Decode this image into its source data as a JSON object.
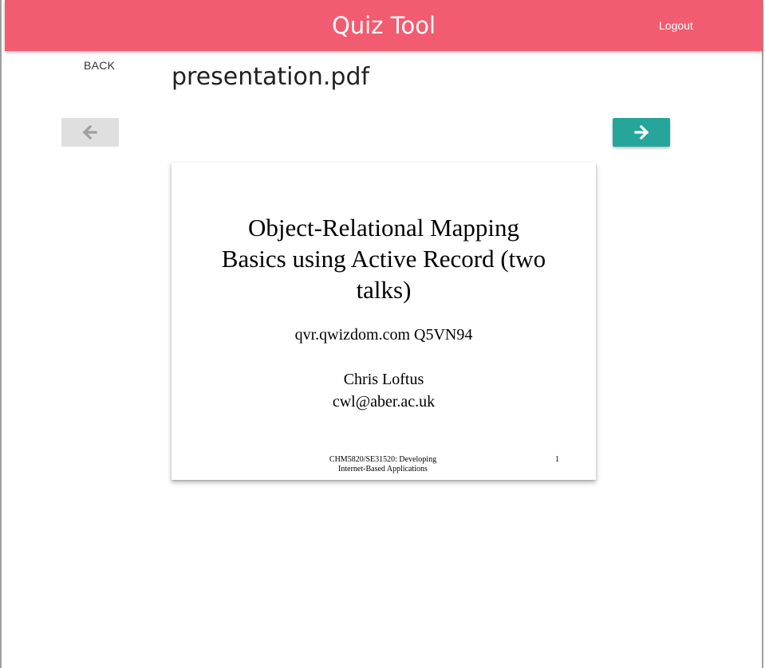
{
  "header": {
    "app_title": "Quiz Tool",
    "logout_label": "Logout",
    "bg_color": "#f25c70"
  },
  "toolbar": {
    "back_label": "BACK",
    "file_name": "presentation.pdf",
    "prev_icon": "arrow-left-icon",
    "next_icon": "arrow-right-icon",
    "next_color": "#26a69a"
  },
  "slide": {
    "title_lines": [
      "Object-Relational Mapping",
      "Basics using Active Record (two",
      "talks)"
    ],
    "code": "qvr.qwizdom.com Q5VN94",
    "author": "Chris Loftus",
    "email": "cwl@aber.ac.uk",
    "footer_lines": [
      "CHM5820/SE31520: Developing",
      "Internet-Based Applications"
    ],
    "page_number": "1"
  }
}
